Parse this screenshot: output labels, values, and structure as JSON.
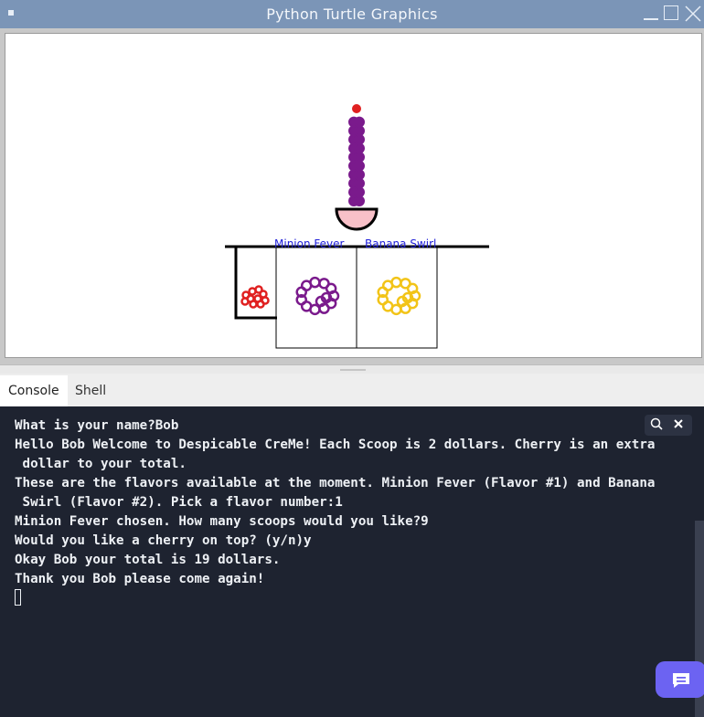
{
  "window": {
    "title": "Python Turtle Graphics"
  },
  "turtle": {
    "labels": [
      "Minion Fever",
      "Banana Swirl"
    ],
    "colors": {
      "cherry": "#e02020",
      "grape": "#7a1a8c",
      "banana": "#f2c418",
      "bowl": "#f8c0c8",
      "label": "#2020d8"
    }
  },
  "tabs": [
    {
      "label": "Console",
      "active": true
    },
    {
      "label": "Shell",
      "active": false
    }
  ],
  "console": {
    "lines": [
      "What is your name?Bob",
      "Hello Bob Welcome to Despicable CreMe! Each Scoop is 2 dollars. Cherry is an extra",
      " dollar to your total.",
      "These are the flavors available at the moment. Minion Fever (Flavor #1) and Banana",
      " Swirl (Flavor #2). Pick a flavor number:1",
      "Minion Fever chosen. How many scoops would you like?9",
      "Would you like a cherry on top? (y/n)y",
      "Okay Bob your total is 19 dollars.",
      "Thank you Bob please come again!"
    ],
    "search_icon": "search-icon",
    "close_icon": "close-icon",
    "background": "#1e2330"
  },
  "chat": {
    "icon": "chat-icon",
    "color": "#6c63f2"
  }
}
